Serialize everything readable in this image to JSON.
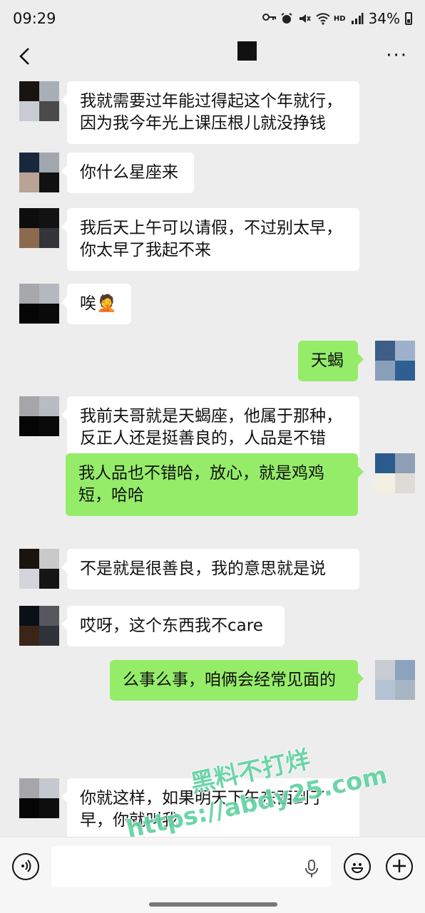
{
  "status": {
    "time": "09:29",
    "battery": "34%",
    "hd_label": "HD"
  },
  "nav": {
    "back_icon": "chevron-left-icon",
    "more_icon": "more-dots-icon",
    "more_label": "···"
  },
  "messages": [
    {
      "side": "in",
      "lines": [
        "我就需要过年能过得起这个年就行，",
        "因为我今年光上课压根儿就没挣钱"
      ],
      "avatar_colors": [
        "#1a1410",
        "#a9afb8",
        "#c9cbd4",
        "#4a4a4a"
      ]
    },
    {
      "side": "in",
      "lines": [
        "你什么星座来"
      ],
      "avatar_colors": [
        "#18283c",
        "#a2a6ad",
        "#b9a394",
        "#111111"
      ]
    },
    {
      "side": "in",
      "lines": [
        "我后天上午可以请假，不过别太早，",
        "你太早了我起不来"
      ],
      "avatar_colors": [
        "#0d0d0d",
        "#121212",
        "#8c6a50",
        "#333538"
      ]
    },
    {
      "side": "in",
      "lines": [
        "唉🤦"
      ],
      "avatar_colors": [
        "#a7a8ab",
        "#b4b8c1",
        "#050505",
        "#0a0a0a"
      ]
    },
    {
      "side": "out",
      "lines": [
        "天蝎"
      ],
      "avatar_colors": [
        "#3d5e86",
        "#9db1cc",
        "#8aa0ba",
        "#2f5f92"
      ]
    },
    {
      "side": "in",
      "lines": [
        "我前夫哥就是天蝎座，他属于那种，",
        "反正人还是挺善良的，人品是不错"
      ],
      "avatar_colors": [
        "#a6a6aa",
        "#b8bbc1",
        "#050505",
        "#0a0a0a"
      ]
    },
    {
      "side": "out",
      "lines": [
        "我人品也不错哈，放心，就是鸡鸡",
        "短，哈哈"
      ],
      "avatar_colors": [
        "#2b5b8c",
        "#8e9fb6",
        "#f3efe2",
        "#dedbd5"
      ]
    },
    {
      "side": "in",
      "lines": [
        "不是就是很善良，我的意思就是说"
      ],
      "avatar_colors": [
        "#1a1410",
        "#c9c9c9",
        "#d3d4dc",
        "#151515"
      ]
    },
    {
      "side": "in",
      "lines": [
        "哎呀，这个东西我不care"
      ],
      "avatar_colors": [
        "#0b1016",
        "#56585e",
        "#3a2518",
        "#2f3238"
      ]
    },
    {
      "side": "out",
      "lines": [
        "么事么事，咱俩会经常见面的"
      ],
      "avatar_colors": [
        "#c8ccd3",
        "#8ca2bd",
        "#b4c4d4",
        "#a8b6c3"
      ]
    },
    {
      "side": "in",
      "lines": [
        "你就这样，如果明天下午东西到了",
        "早，你就叫我"
      ],
      "avatar_colors": [
        "#a6a6aa",
        "#c4c8d0",
        "#050505",
        "#0e0e0e"
      ]
    }
  ],
  "watermark": {
    "line1": "黑料不打烊",
    "line2": "https://abdy25.com"
  },
  "input_bar": {
    "voice_icon": "voice-icon",
    "mic_icon": "microphone-icon",
    "emoji_icon": "emoji-icon",
    "plus_icon": "plus-icon"
  }
}
